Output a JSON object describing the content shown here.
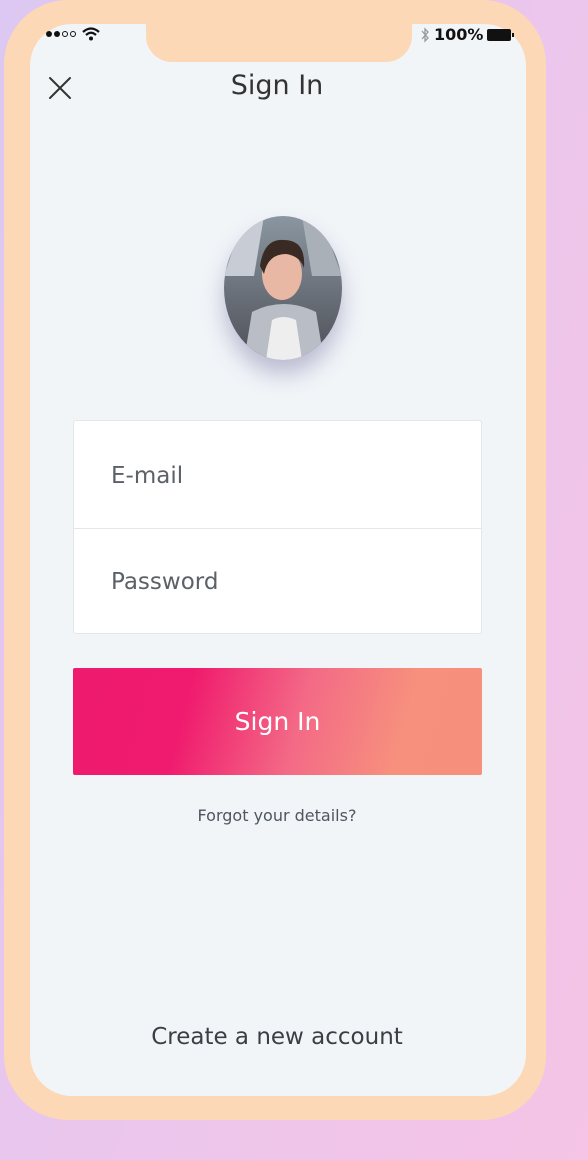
{
  "status_bar": {
    "battery_text": "100%",
    "icons": [
      "signal-icon",
      "wifi-icon",
      "bluetooth-icon",
      "battery-icon"
    ]
  },
  "header": {
    "title": "Sign In",
    "close_icon": "close-icon"
  },
  "form": {
    "email_placeholder": "E-mail",
    "password_placeholder": "Password",
    "email_value": "",
    "password_value": ""
  },
  "actions": {
    "sign_in_label": "Sign In",
    "forgot_label": "Forgot your details?",
    "create_account_label": "Create a new account"
  },
  "colors": {
    "frame": "#fcd8b6",
    "screen": "#f1f5f8",
    "button_gradient_start": "#ee1a6d",
    "button_gradient_end": "#f68f7c"
  }
}
